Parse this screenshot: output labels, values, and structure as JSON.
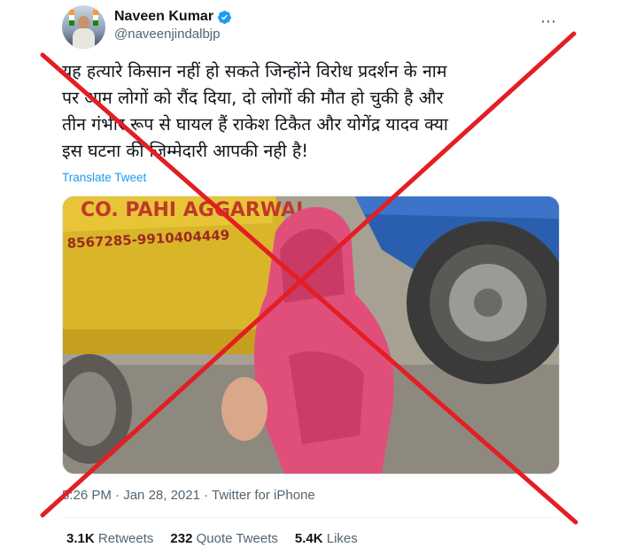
{
  "author": {
    "display_name": "Naveen Kumar",
    "handle": "@naveenjindalbjp",
    "verified": true,
    "avatar_icon": "avatar-photo"
  },
  "more_icon": "⋯",
  "tweet": {
    "lines": [
      "यह हत्यारे किसान नहीं हो सकते जिन्होंने विरोध प्रदर्शन के नाम",
      "पर आम लोगों को रौंद दिया, दो लोगों की मौत हो चुकी है और",
      "तीन गंभीर रूप से  घायल हैं राकेश टिकैत और योगेंद्र यादव क्या",
      "इस घटना की जिम्मेदारी आपकी नही है!"
    ],
    "translate_label": "Translate Tweet"
  },
  "media": {
    "truck_text_top": "CO. PAHI AGGARWAL",
    "truck_text_phone": "8567285-9910404449"
  },
  "meta": {
    "time": "5:26 PM",
    "separator1": " · ",
    "date": "Jan 28, 2021",
    "separator2": " · ",
    "source": "Twitter for iPhone"
  },
  "stats": {
    "retweets_count": "3.1K",
    "retweets_label": "Retweets",
    "quotes_count": "232",
    "quotes_label": "Quote Tweets",
    "likes_count": "5.4K",
    "likes_label": "Likes"
  },
  "colors": {
    "cross": "#e31e24",
    "link": "#1d9bf0",
    "verified": "#1d9bf0"
  }
}
